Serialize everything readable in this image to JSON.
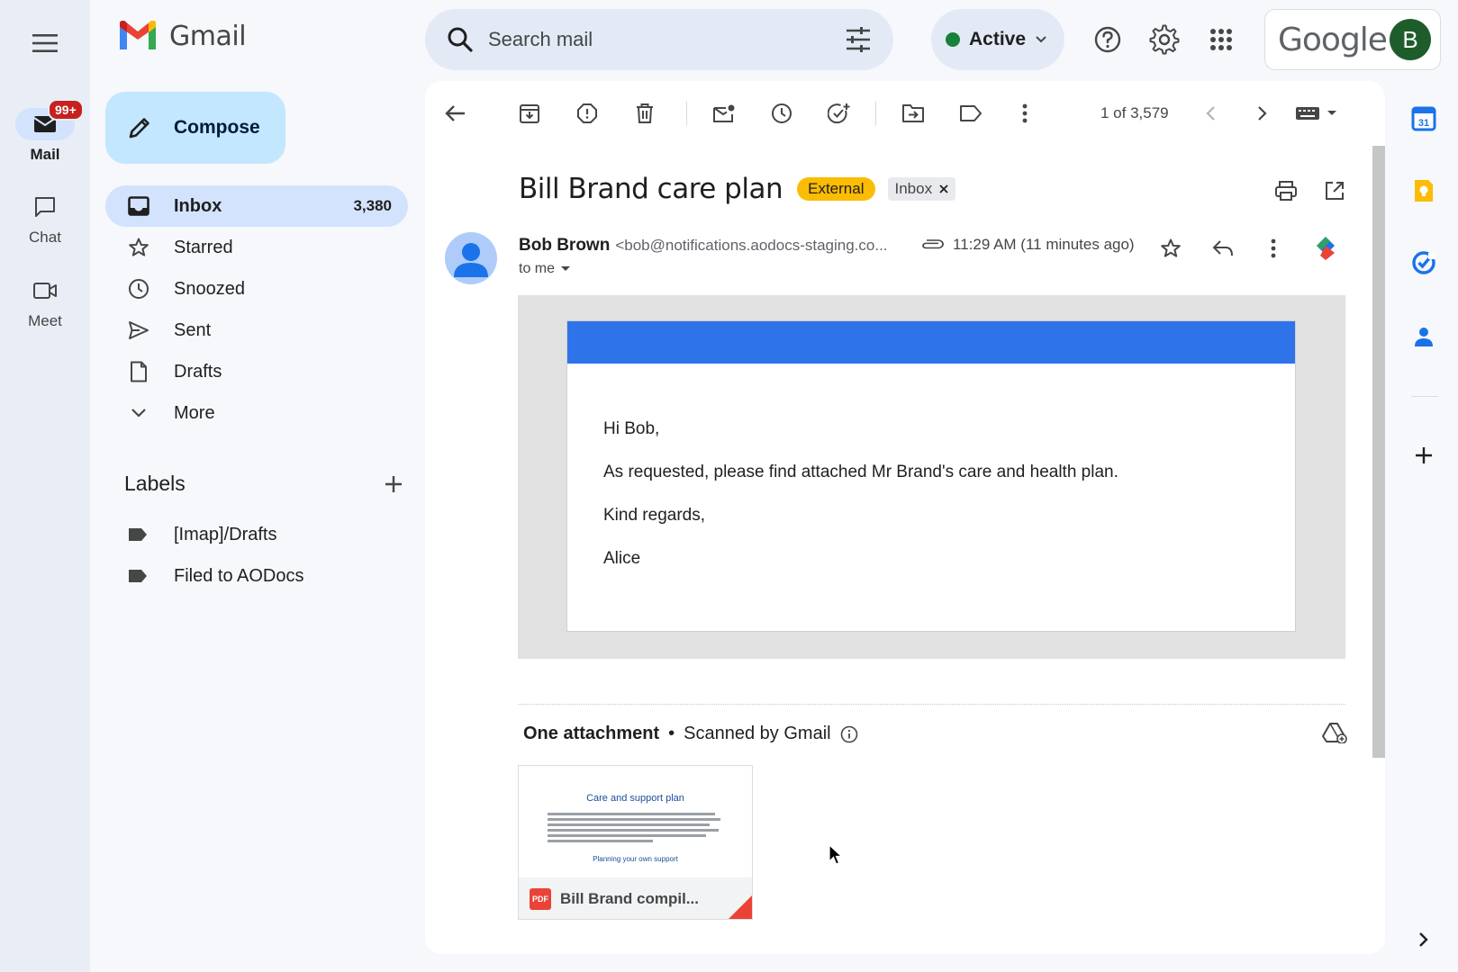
{
  "app": {
    "name": "Gmail",
    "account_initial": "B",
    "google_word": "Google"
  },
  "rail": {
    "items": [
      {
        "label": "Mail",
        "badge": "99+"
      },
      {
        "label": "Chat"
      },
      {
        "label": "Meet"
      }
    ]
  },
  "search": {
    "placeholder": "Search mail"
  },
  "status": {
    "label": "Active"
  },
  "compose": {
    "label": "Compose"
  },
  "nav": {
    "items": [
      {
        "label": "Inbox",
        "count": "3,380"
      },
      {
        "label": "Starred"
      },
      {
        "label": "Snoozed"
      },
      {
        "label": "Sent"
      },
      {
        "label": "Drafts"
      },
      {
        "label": "More"
      }
    ]
  },
  "labels": {
    "heading": "Labels",
    "items": [
      "[Imap]/Drafts",
      "Filed to AODocs"
    ]
  },
  "toolbar": {
    "pager": "1 of 3,579"
  },
  "email": {
    "subject": "Bill Brand care plan",
    "tags": {
      "external": "External",
      "inbox": "Inbox"
    },
    "sender_name": "Bob Brown",
    "sender_email": "<bob@notifications.aodocs-staging.co...",
    "time": "11:29 AM (11 minutes ago)",
    "to": "to me",
    "body": [
      "Hi Bob,",
      "As requested, please find attached Mr Brand's care and health plan.",
      "Kind regards,",
      "Alice"
    ]
  },
  "attachments": {
    "heading": "One attachment",
    "scanned": "Scanned by Gmail",
    "file": {
      "name": "Bill Brand compil...",
      "type": "PDF",
      "preview_title": "Care and support plan",
      "preview_subtitle": "Planning your own support"
    }
  },
  "colors": {
    "accent": "#0b57d0",
    "compose": "#c2e7ff",
    "external_tag": "#fbbc04",
    "mail_header": "#2e73ea",
    "active_dot": "#188038"
  }
}
